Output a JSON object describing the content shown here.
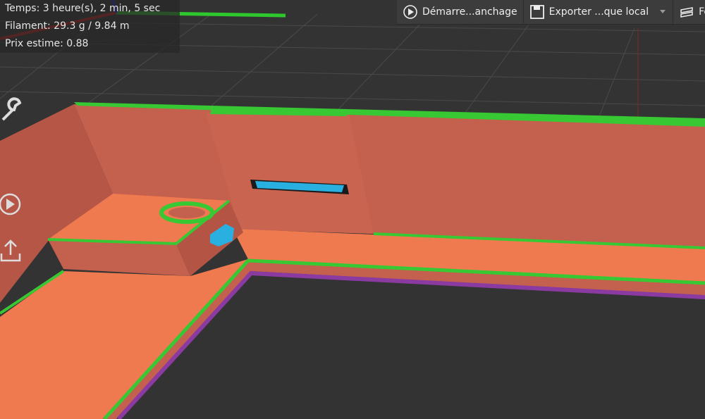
{
  "stats": {
    "time": "Temps: 3 heure(s), 2 min, 5 sec",
    "filament": "Filament: 29.3 g / 9.84 m",
    "price": "Prix estime: 0.88"
  },
  "toolbar": {
    "start_label": "Démarre...anchage",
    "export_label": "Exporter ...que local",
    "layers_label": "Fe"
  },
  "side_tools": [
    "wrench-icon",
    "play-icon",
    "upload-icon"
  ],
  "colors": {
    "wall": "#c4604e",
    "infill": "#f07a50",
    "outer": "#38c833",
    "support": "#2ab0e0",
    "skirt": "#8a3aa0"
  }
}
